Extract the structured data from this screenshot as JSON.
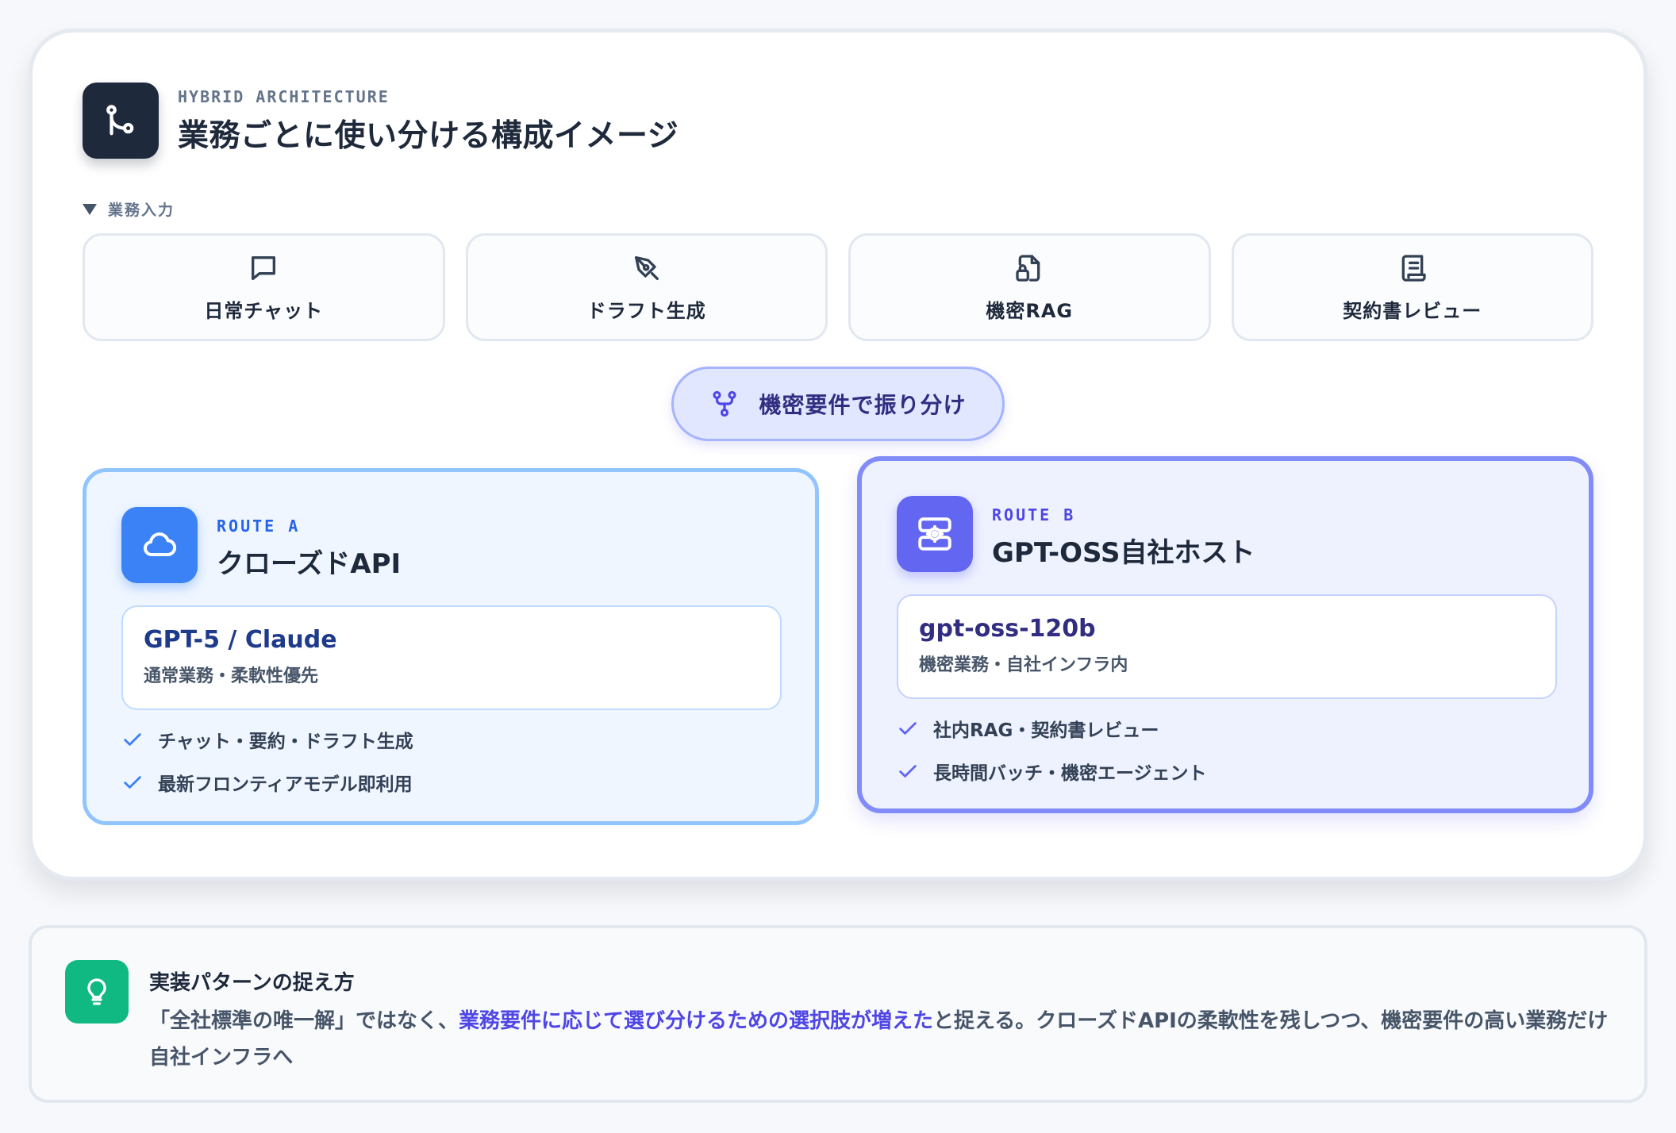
{
  "header": {
    "eyebrow": "HYBRID ARCHITECTURE",
    "title": "業務ごとに使い分ける構成イメージ",
    "icon": "git-branch-icon"
  },
  "input_section": {
    "label": "業務入力",
    "tiles": [
      {
        "label": "日常チャット",
        "icon": "chat-bubble-icon"
      },
      {
        "label": "ドラフト生成",
        "icon": "pen-tool-icon"
      },
      {
        "label": "機密RAG",
        "icon": "file-lock-icon"
      },
      {
        "label": "契約書レビュー",
        "icon": "scroll-icon"
      }
    ]
  },
  "router": {
    "label": "機密要件で振り分け",
    "icon": "git-fork-icon"
  },
  "routes": [
    {
      "tag": "ROUTE A",
      "name": "クローズドAPI",
      "icon": "cloud-icon",
      "model": "GPT-5 / Claude",
      "model_desc": "通常業務・柔軟性優先",
      "checks": [
        "チャット・要約・ドラフト生成",
        "最新フロンティアモデル即利用"
      ]
    },
    {
      "tag": "ROUTE B",
      "name": "GPT-OSS自社ホスト",
      "icon": "server-cog-icon",
      "model": "gpt-oss-120b",
      "model_desc": "機密業務・自社インフラ内",
      "checks": [
        "社内RAG・契約書レビュー",
        "長時間バッチ・機密エージェント"
      ]
    }
  ],
  "tip": {
    "icon": "lightbulb-icon",
    "title": "実装パターンの捉え方",
    "body_before": "「全社標準の唯一解」ではなく、",
    "body_highlight": "業務要件に応じて選び分けるための選択肢が増えた",
    "body_after": "と捉える。クローズドAPIの柔軟性を残しつつ、機密要件の高い業務だけ自社インフラへ"
  },
  "colors": {
    "dark": "#1e293b",
    "route_a_accent": "#3b82f6",
    "route_b_accent": "#6366f1",
    "tip_accent": "#10b981",
    "highlight": "#4f46e5"
  }
}
